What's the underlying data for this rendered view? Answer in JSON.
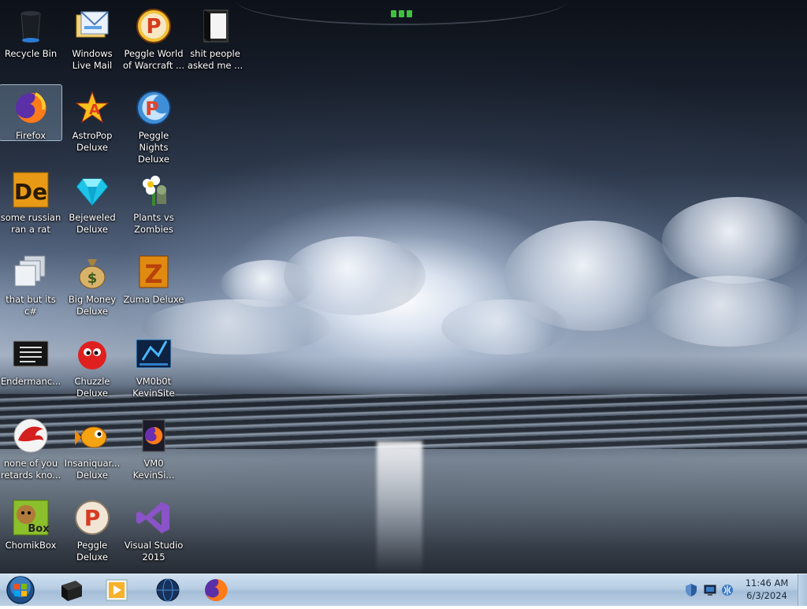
{
  "desktop": {
    "icons": [
      {
        "label": "Recycle Bin",
        "icon": "recycle-bin-icon"
      },
      {
        "label": "Windows Live Mail",
        "icon": "mail-icon"
      },
      {
        "label": "Peggle World of Warcraft ...",
        "icon": "peggle-icon"
      },
      {
        "label": "shit people asked me ...",
        "icon": "folder-icon"
      },
      {
        "label": "Firefox",
        "icon": "firefox-icon"
      },
      {
        "label": "AstroPop Deluxe",
        "icon": "astropop-icon"
      },
      {
        "label": "Peggle Nights Deluxe",
        "icon": "peggle-nights-icon"
      },
      {
        "label": "some russian ran a rat",
        "icon": "de-app-icon"
      },
      {
        "label": "Bejeweled Deluxe",
        "icon": "gem-icon"
      },
      {
        "label": "Plants vs Zombies",
        "icon": "flower-icon"
      },
      {
        "label": "that but its c#",
        "icon": "stacked-windows-icon"
      },
      {
        "label": "Big Money Deluxe",
        "icon": "money-bag-icon"
      },
      {
        "label": "Zuma Deluxe",
        "icon": "zuma-icon"
      },
      {
        "label": "Endermanc...",
        "icon": "terminal-icon"
      },
      {
        "label": "Chuzzle Deluxe",
        "icon": "chuzzle-icon"
      },
      {
        "label": "VM0b0t KevinSite",
        "icon": "vmware-icon"
      },
      {
        "label": "none of you retards kno...",
        "icon": "red-dragon-icon"
      },
      {
        "label": "Insaniquar... Deluxe",
        "icon": "goldfish-icon"
      },
      {
        "label": "VM0 KevinSi...",
        "icon": "firefox-doc-icon"
      },
      {
        "label": "ChomikBox",
        "icon": "hamster-box-icon"
      },
      {
        "label": "Peggle Deluxe",
        "icon": "peggle-deluxe-icon"
      },
      {
        "label": "Visual Studio 2015",
        "icon": "visual-studio-icon"
      }
    ],
    "selected_label": "Firefox"
  },
  "taskbar": {
    "start": "start-orb-icon",
    "pinned": [
      "black-cube-icon",
      "media-player-icon",
      "globe-app-icon",
      "firefox-icon"
    ],
    "tray": [
      "shield-icon",
      "monitor-icon",
      "network-icon"
    ],
    "clock": {
      "time": "11:46 AM",
      "date": "6/3/2024"
    }
  },
  "colors": {
    "taskbar": "#b7cde3",
    "selection": "#96b4d2",
    "label_text": "#ffffff"
  }
}
